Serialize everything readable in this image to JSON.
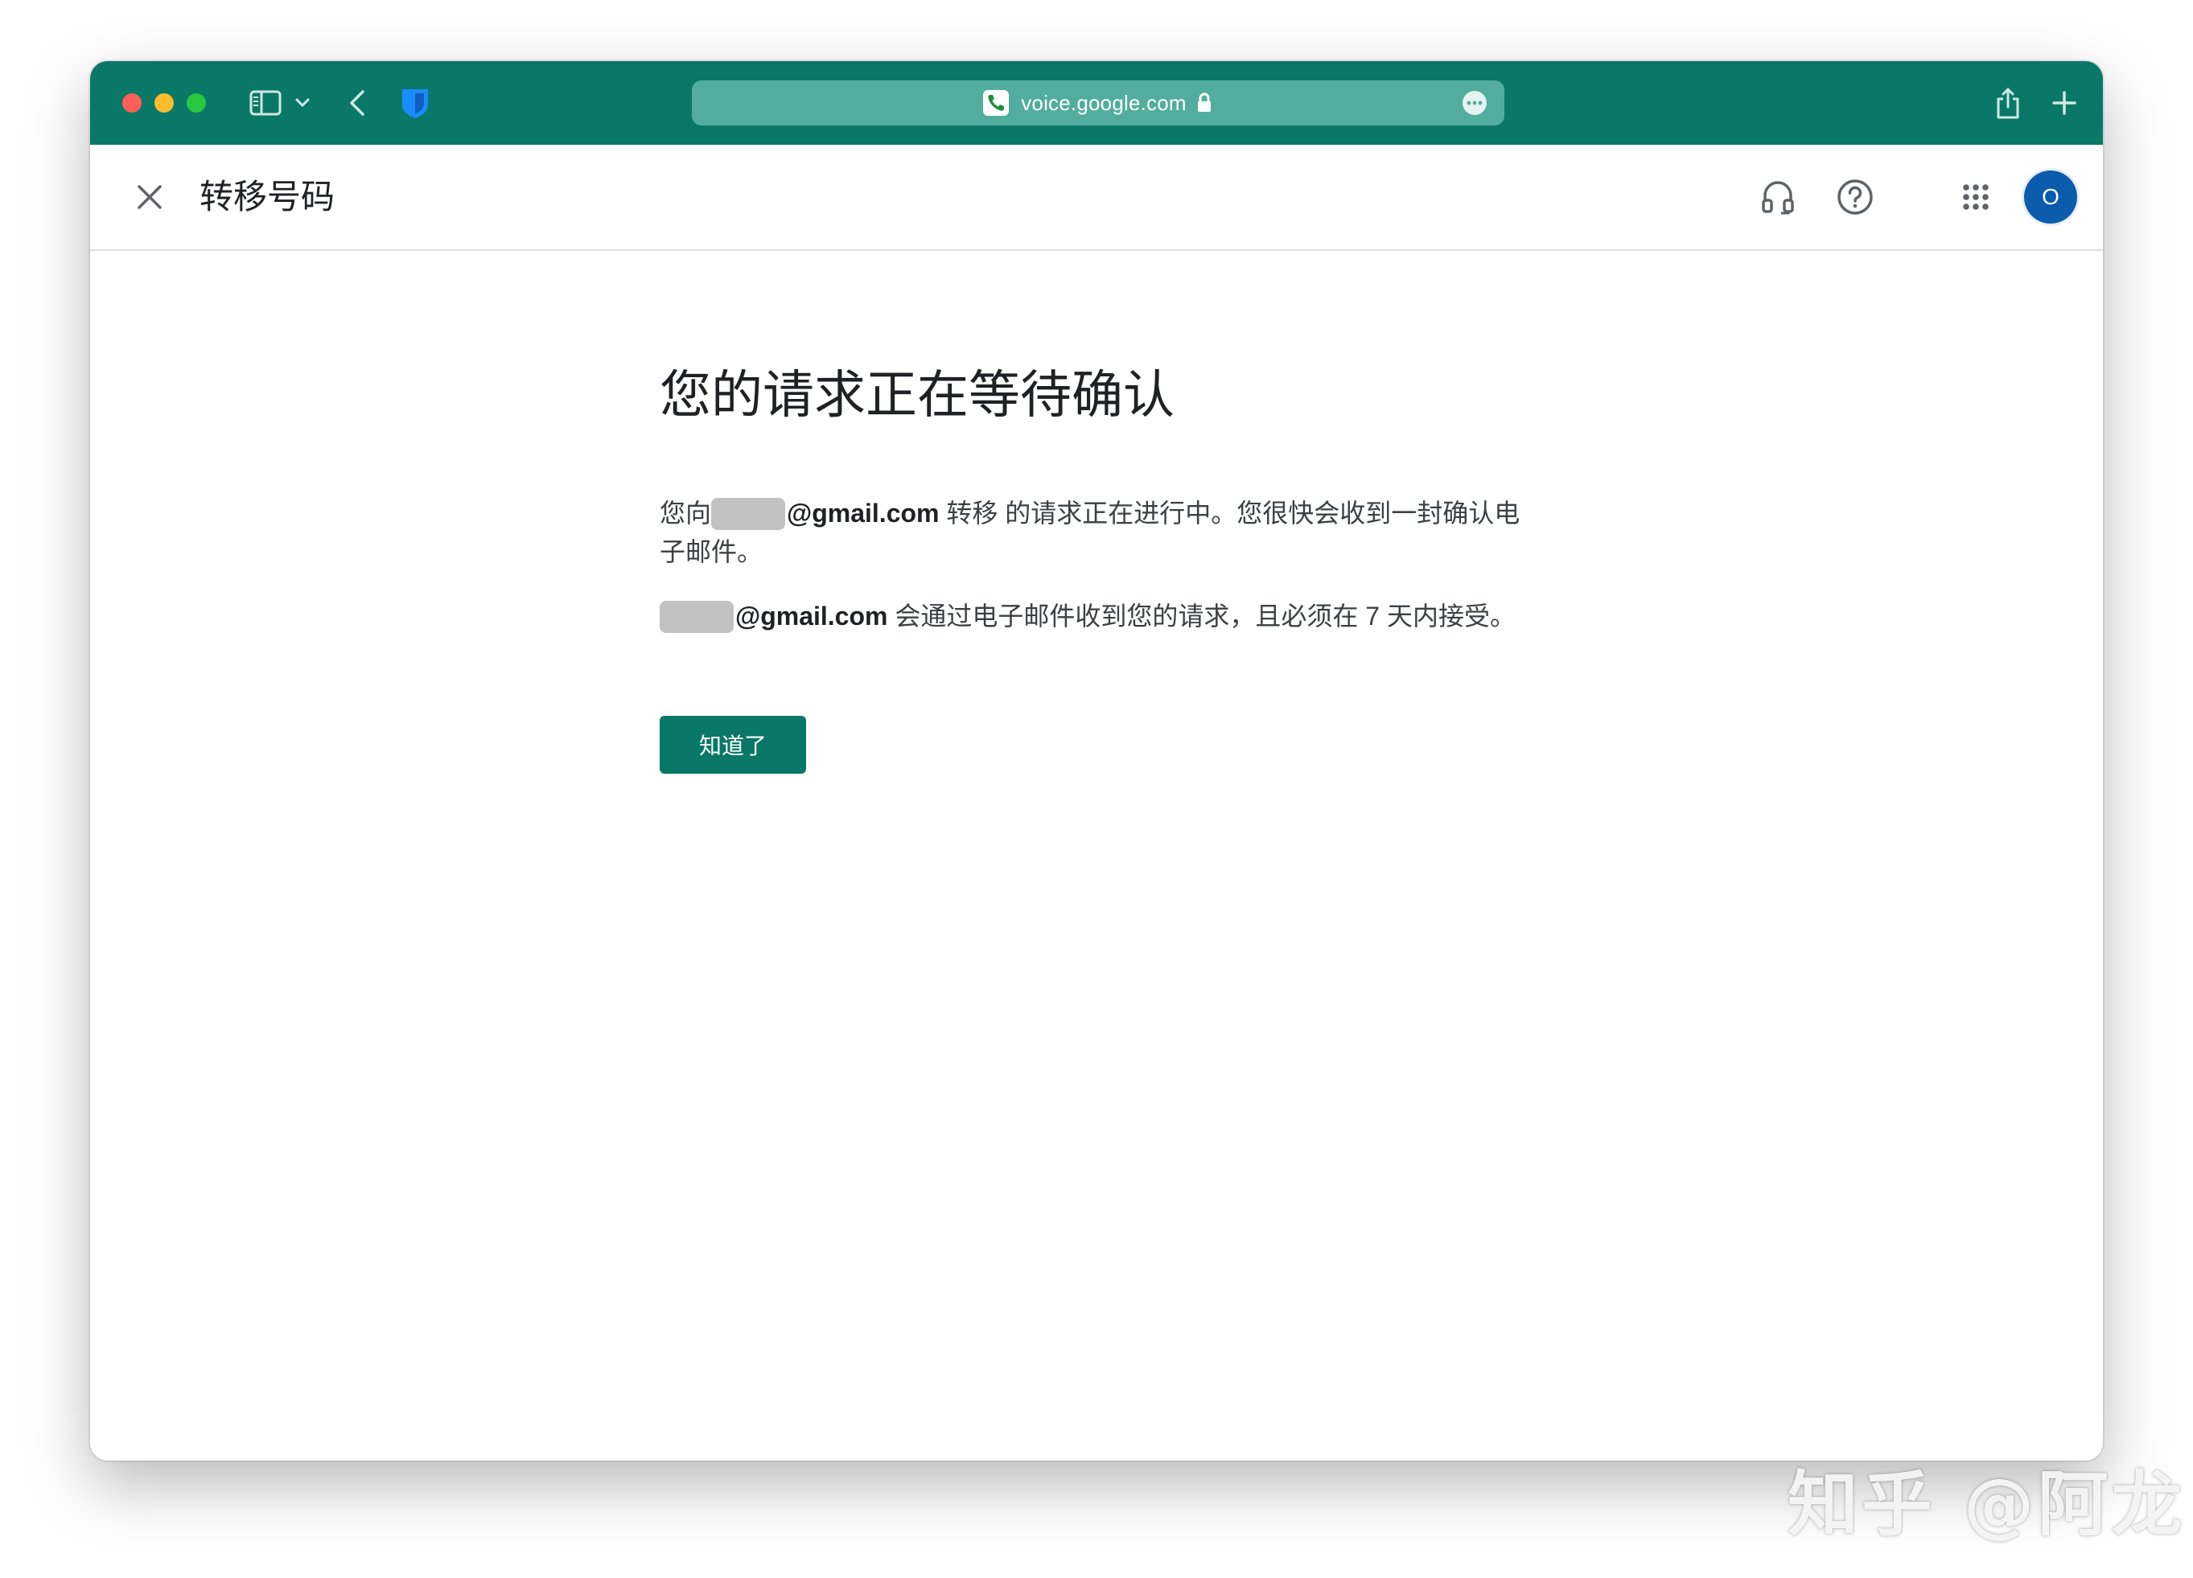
{
  "browser": {
    "url": "voice.google.com",
    "toolbar_color": "#0a7867"
  },
  "header": {
    "title": "转移号码",
    "avatar_initial": "O",
    "avatar_color": "#0b5cad"
  },
  "main": {
    "heading": "您的请求正在等待确认",
    "para1": {
      "prefix": "您向",
      "email": "@gmail.com",
      "suffix": " 转移 的请求正在进行中。您很快会收到一封确认电子邮件。"
    },
    "para2": {
      "email": "@gmail.com",
      "suffix": " 会通过电子邮件收到您的请求，且必须在 7 天内接受。"
    },
    "button_label": "知道了"
  },
  "watermark": "知乎 @阿龙",
  "icons": [
    "close-icon",
    "headset-icon",
    "help-icon",
    "apps-grid-icon",
    "sidebar-icon",
    "chevron-down-icon",
    "back-icon",
    "shield-icon",
    "phone-icon",
    "lock-icon",
    "more-icon",
    "share-icon",
    "plus-icon"
  ]
}
